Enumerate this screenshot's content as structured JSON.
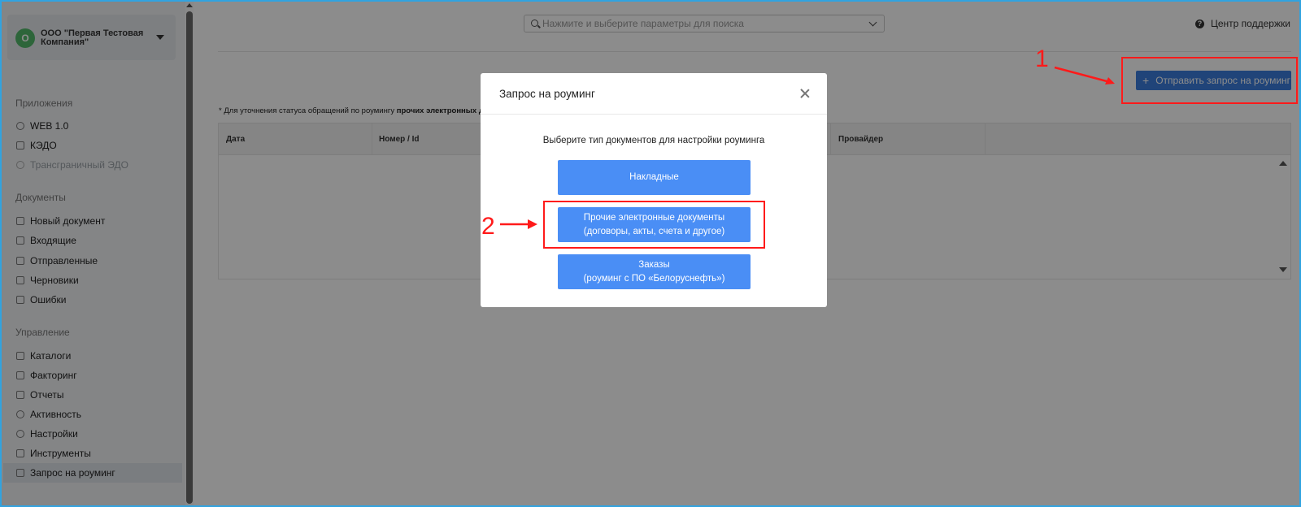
{
  "company": {
    "initial": "О",
    "name": "ООО \"Первая Тестовая Компания\""
  },
  "sidebar": {
    "sections": [
      {
        "title": "Приложения",
        "items": [
          {
            "label": "WEB 1.0",
            "icon": "refresh-icon",
            "state": "normal"
          },
          {
            "label": "КЭДО",
            "icon": "document-icon",
            "state": "normal"
          },
          {
            "label": "Трансграничный ЭДО",
            "icon": "globe-icon",
            "state": "disabled"
          }
        ]
      },
      {
        "title": "Документы",
        "items": [
          {
            "label": "Новый документ",
            "icon": "file-icon"
          },
          {
            "label": "Входящие",
            "icon": "inbox-icon"
          },
          {
            "label": "Отправленные",
            "icon": "send-icon"
          },
          {
            "label": "Черновики",
            "icon": "file-icon"
          },
          {
            "label": "Ошибки",
            "icon": "file-icon"
          }
        ]
      },
      {
        "title": "Управление",
        "items": [
          {
            "label": "Каталоги",
            "icon": "catalog-icon"
          },
          {
            "label": "Факторинг",
            "icon": "chart-icon"
          },
          {
            "label": "Отчеты",
            "icon": "report-icon"
          },
          {
            "label": "Активность",
            "icon": "search-icon"
          },
          {
            "label": "Настройки",
            "icon": "gear-icon"
          },
          {
            "label": "Инструменты",
            "icon": "wrench-icon"
          },
          {
            "label": "Запрос на роуминг",
            "icon": "list-icon",
            "state": "active"
          }
        ]
      }
    ]
  },
  "search": {
    "placeholder": "Нажмите и выберите параметры для поиска"
  },
  "help": {
    "label": "Центр поддержки"
  },
  "toolbar": {
    "roaming_button_label": "Отправить запрос на роуминг"
  },
  "note": {
    "prefix": "* Для уточнения статуса обращений по роумингу ",
    "bold": "прочих электронных до"
  },
  "table": {
    "columns": [
      "Дата",
      "Номер / Id",
      "Провайдер"
    ]
  },
  "modal": {
    "title": "Запрос на роуминг",
    "subtitle": "Выберите тип документов для настройки роуминга",
    "buttons": [
      {
        "line1": "Накладные",
        "line2": ""
      },
      {
        "line1": "Прочие электронные документы",
        "line2": "(договоры, акты, счета и другое)"
      },
      {
        "line1": "Заказы",
        "line2": "(роуминг с ПО «Белоруснефть»)"
      }
    ]
  },
  "annotations": {
    "step1": "1",
    "step2": "2",
    "color": "#ff1a1a"
  },
  "colors": {
    "primary": "#4a8ef5",
    "sidebar_bg": "#f0f2f5",
    "accent_border": "#31a3e0"
  }
}
